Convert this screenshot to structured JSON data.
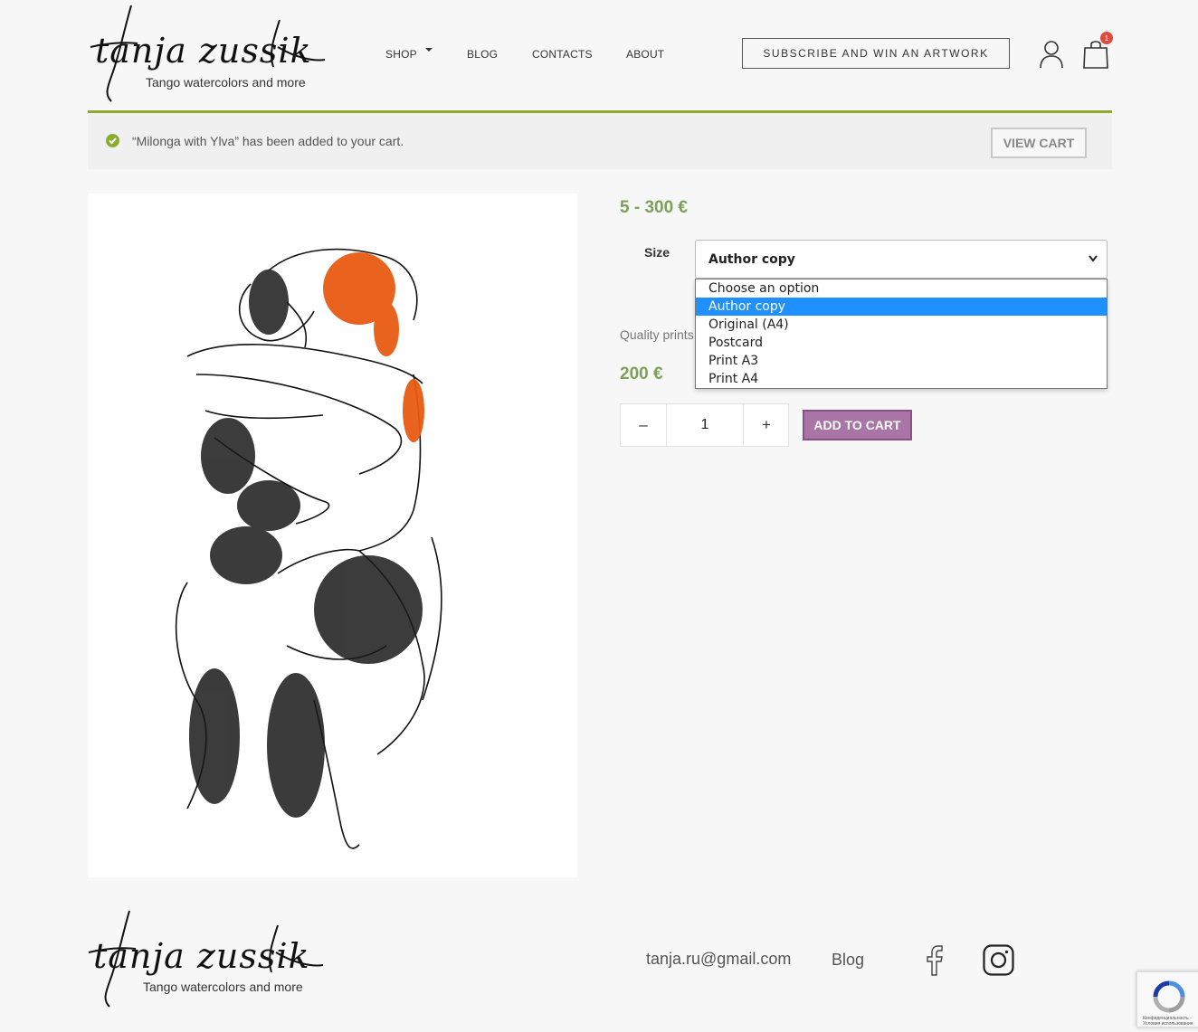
{
  "header": {
    "logo_script": "tanja zussik",
    "logo_tagline": "Tango watercolors and more",
    "nav": [
      {
        "label": "SHOP"
      },
      {
        "label": "BLOG"
      },
      {
        "label": "CONTACTS"
      },
      {
        "label": "ABOUT"
      }
    ],
    "subscribe_label": "SUBSCRIBE AND WIN AN ARTWORK",
    "cart_count": "1"
  },
  "notice": {
    "message": "“Milonga with Ylva” has been added to your cart.",
    "view_cart_label": "VIEW CART"
  },
  "product": {
    "price_range": "5 - 300 €",
    "size_label": "Size",
    "size_selected": "Author copy",
    "size_options": [
      "Choose an option",
      "Author copy",
      "Original (A4)",
      "Postcard",
      "Print A3",
      "Print A4"
    ],
    "quality_text": "Quality prints",
    "price": "200 €",
    "quantity": "1",
    "minus_label": "–",
    "plus_label": "+",
    "add_to_cart_label": "ADD TO CART"
  },
  "footer": {
    "logo_script": "tanja zussik",
    "logo_tagline": "Tango watercolors and more",
    "email": "tanja.ru@gmail.com",
    "blog_label": "Blog",
    "recaptcha_terms": "Конфиденциальность - Условия использования"
  },
  "colors": {
    "accent_green": "#8bad2e",
    "price_green": "#7da05b",
    "button_purple": "#a974a6",
    "badge_red": "#e04a3f",
    "selected_option_blue": "#1e90ff"
  }
}
